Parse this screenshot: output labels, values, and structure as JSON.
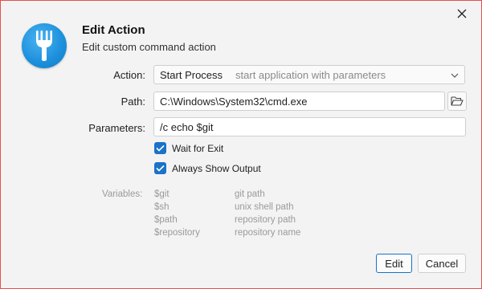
{
  "dialog": {
    "title": "Edit Action",
    "subtitle": "Edit custom command action",
    "close_icon": "close-icon",
    "logo_icon": "fork-icon"
  },
  "form": {
    "action": {
      "label": "Action:",
      "selected": "Start Process",
      "hint": "start application with parameters"
    },
    "path": {
      "label": "Path:",
      "value": "C:\\Windows\\System32\\cmd.exe",
      "browse_icon": "folder-open-icon"
    },
    "parameters": {
      "label": "Parameters:",
      "value": "/c echo $git"
    },
    "checkboxes": [
      {
        "label": "Wait for Exit",
        "checked": true
      },
      {
        "label": "Always Show Output",
        "checked": true
      }
    ]
  },
  "variables": {
    "label": "Variables:",
    "items": [
      {
        "name": "$git",
        "desc": "git path"
      },
      {
        "name": "$sh",
        "desc": "unix shell path"
      },
      {
        "name": "$path",
        "desc": "repository path"
      },
      {
        "name": "$repository",
        "desc": "repository name"
      }
    ]
  },
  "buttons": {
    "edit": "Edit",
    "cancel": "Cancel"
  },
  "colors": {
    "accent": "#1a73c9",
    "window_border": "#e5504f",
    "logo": "#1c8fdb"
  }
}
